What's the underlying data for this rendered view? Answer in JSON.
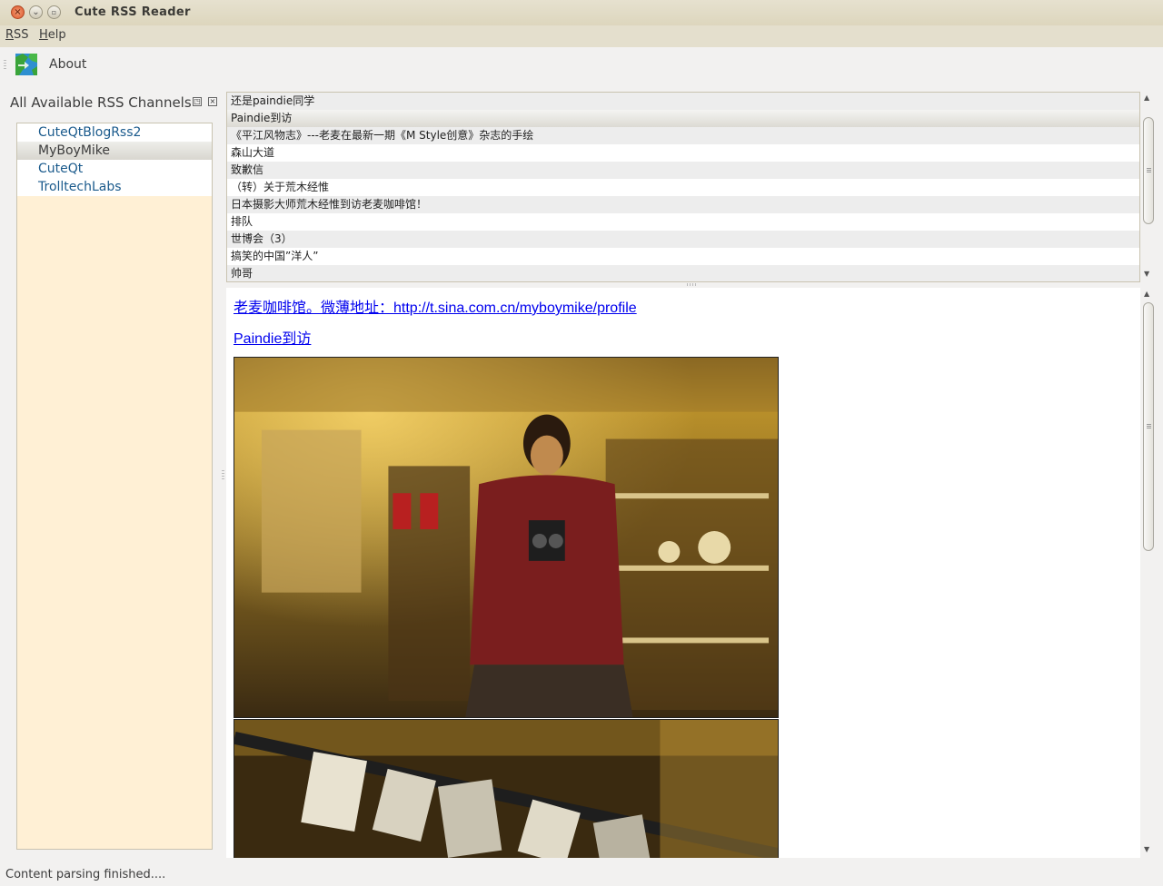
{
  "window": {
    "title": "Cute RSS Reader",
    "controls": {
      "close": "×",
      "minimize": "⌄",
      "maximize": "▫"
    }
  },
  "menubar": {
    "items": [
      {
        "accel": "R",
        "rest": "SS"
      },
      {
        "accel": "H",
        "rest": "elp"
      }
    ]
  },
  "toolbar": {
    "about_label": "About",
    "about_icon": "about-globe-icon"
  },
  "channels_dock": {
    "title": "All Available RSS Channels",
    "float_icon": "◳",
    "close_icon": "×",
    "items": [
      "CuteQtBlogRss2",
      "MyBoyMike",
      "CuteQt",
      "TrolltechLabs"
    ],
    "selected_index": 1
  },
  "posts": {
    "items": [
      "还是paindie同学",
      "Paindie到访",
      "《平江风物志》---老麦在最新一期《M Style创意》杂志的手绘",
      "森山大道",
      "致歉信",
      "（转）关于荒木经惟",
      "日本摄影大师荒木经惟到访老麦咖啡馆！",
      "排队",
      "世博会（3）",
      "搞笑的中国”洋人”",
      "帅哥"
    ],
    "selected_index": 1
  },
  "content": {
    "link1": "老麦咖啡馆。微薄地址：http://t.sina.com.cn/myboymike/profile",
    "link2": "Paindie到访"
  },
  "status": {
    "text": "Content parsing finished...."
  },
  "colors": {
    "titlebar": "#e1dbc6",
    "menubar": "#e4dfcd",
    "channel_list_bg": "#fff0d5",
    "channel_link": "#1a5a8c",
    "content_link": "#0000ee"
  }
}
